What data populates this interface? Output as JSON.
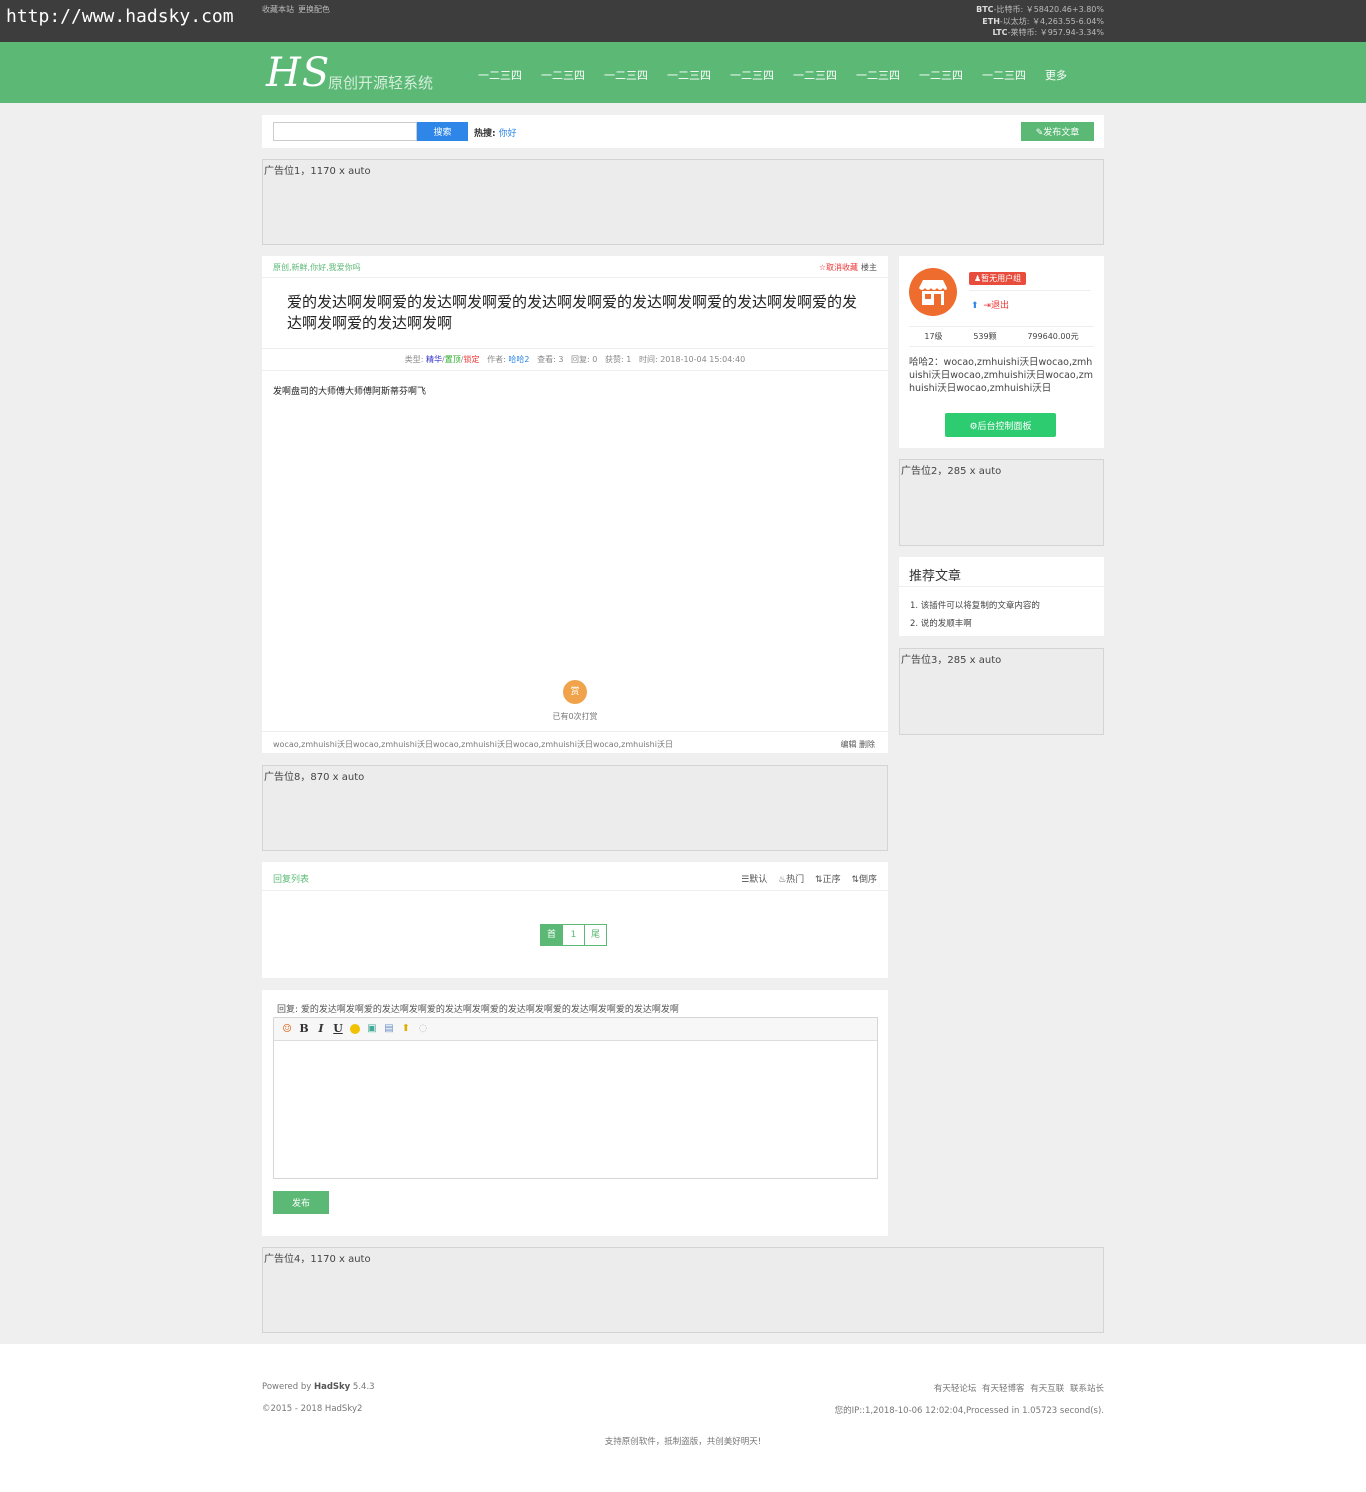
{
  "url_watermark": "http://www.hadsky.com",
  "topbar": {
    "links": [
      "收藏本站",
      "更换配色"
    ],
    "coins": [
      {
        "code": "BTC",
        "name": "-比特币:",
        "value": "￥58420.46+3.80%"
      },
      {
        "code": "ETH",
        "name": "-以太坊:",
        "value": "￥4,263.55-6.04%"
      },
      {
        "code": "LTC",
        "name": "-莱特币:",
        "value": "￥957.94-3.34%"
      }
    ]
  },
  "nav": {
    "logo": "HS",
    "logo_sub": "原创开源轻系统",
    "items": [
      "一二三四",
      "一二三四",
      "一二三四",
      "一二三四",
      "一二三四",
      "一二三四",
      "一二三四",
      "一二三四",
      "一二三四",
      "更多"
    ]
  },
  "search": {
    "placeholder": "",
    "button": "搜索",
    "hot_label": "热搜:",
    "hot_word": "你好",
    "publish": "发布文章"
  },
  "ads": {
    "ad1": "广告位1，1170 x auto",
    "ad2": "广告位2，285 x auto",
    "ad3": "广告位3，285 x auto",
    "ad8": "广告位8，870 x auto",
    "ad4": "广告位4，1170 x auto"
  },
  "article": {
    "tags": "原创,新鲜,你好,我爱你吗",
    "cancel_fav": "☆取消收藏",
    "owner": "楼主",
    "title": "爱的发达啊发啊爱的发达啊发啊爱的发达啊发啊爱的发达啊发啊爱的发达啊发啊爱的发达啊发啊爱的发达啊发啊",
    "meta": {
      "type_label": "类型:",
      "t1": "精华",
      "t2": "置顶",
      "t3": "锁定",
      "author_label": "作者:",
      "author": "哈哈2",
      "views": "查看: 3",
      "replies": "回复: 0",
      "likes": "获赞: 1",
      "time": "时间: 2018-10-04 15:04:40"
    },
    "body": "发啊盘司的大师傅大师傅阿斯蒂芬啊飞",
    "reward_icon": "赏",
    "reward_text": "已有0次打赏",
    "tagline": "wocao,zmhuishi沃日wocao,zmhuishi沃日wocao,zmhuishi沃日wocao,zmhuishi沃日wocao,zmhuishi沃日",
    "edit": "编辑",
    "delete": "删除"
  },
  "replies": {
    "title": "回复列表",
    "sort": [
      "☰默认",
      "♨热门",
      "⇅正序",
      "⇅倒序"
    ],
    "pager": [
      "首",
      "1",
      "尾"
    ]
  },
  "reply_form": {
    "label": "回复:  爱的发达啊发啊爱的发达啊发啊爱的发达啊发啊爱的发达啊发啊爱的发达啊发啊爱的发达啊发啊",
    "submit": "发布"
  },
  "user": {
    "group": "暂无用户组",
    "logout": "退出",
    "level": "17级",
    "points": "539颗",
    "money": "799640.00元",
    "signature": "哈哈2：wocao,zmhuishi沃日wocao,zmhuishi沃日wocao,zmhuishi沃日wocao,zmhuishi沃日wocao,zmhuishi沃日",
    "dashboard": "后台控制面板"
  },
  "recommend": {
    "title": "推荐文章",
    "items": [
      "1. 该插件可以将复制的文章内容的",
      "2. 说的发顺丰啊"
    ]
  },
  "footer": {
    "powered_prefix": "Powered by ",
    "powered_name": "HadSky",
    "version": " 5.4.3",
    "copyright": "©2015 - 2018 HadSky2",
    "links": [
      "有天轻论坛",
      "有天轻博客",
      "有天互联",
      "联系站长"
    ],
    "info": "您的IP::1,2018-10-06 12:02:04,Processed in 1.05723 second(s).",
    "slogan": "支持原创软件，抵制盗版，共创美好明天!"
  },
  "colors": {
    "brand_green": "#5bb975",
    "topbar": "#3d3d3d",
    "link_blue": "#2d86e8",
    "danger_red": "#e84c3d"
  }
}
